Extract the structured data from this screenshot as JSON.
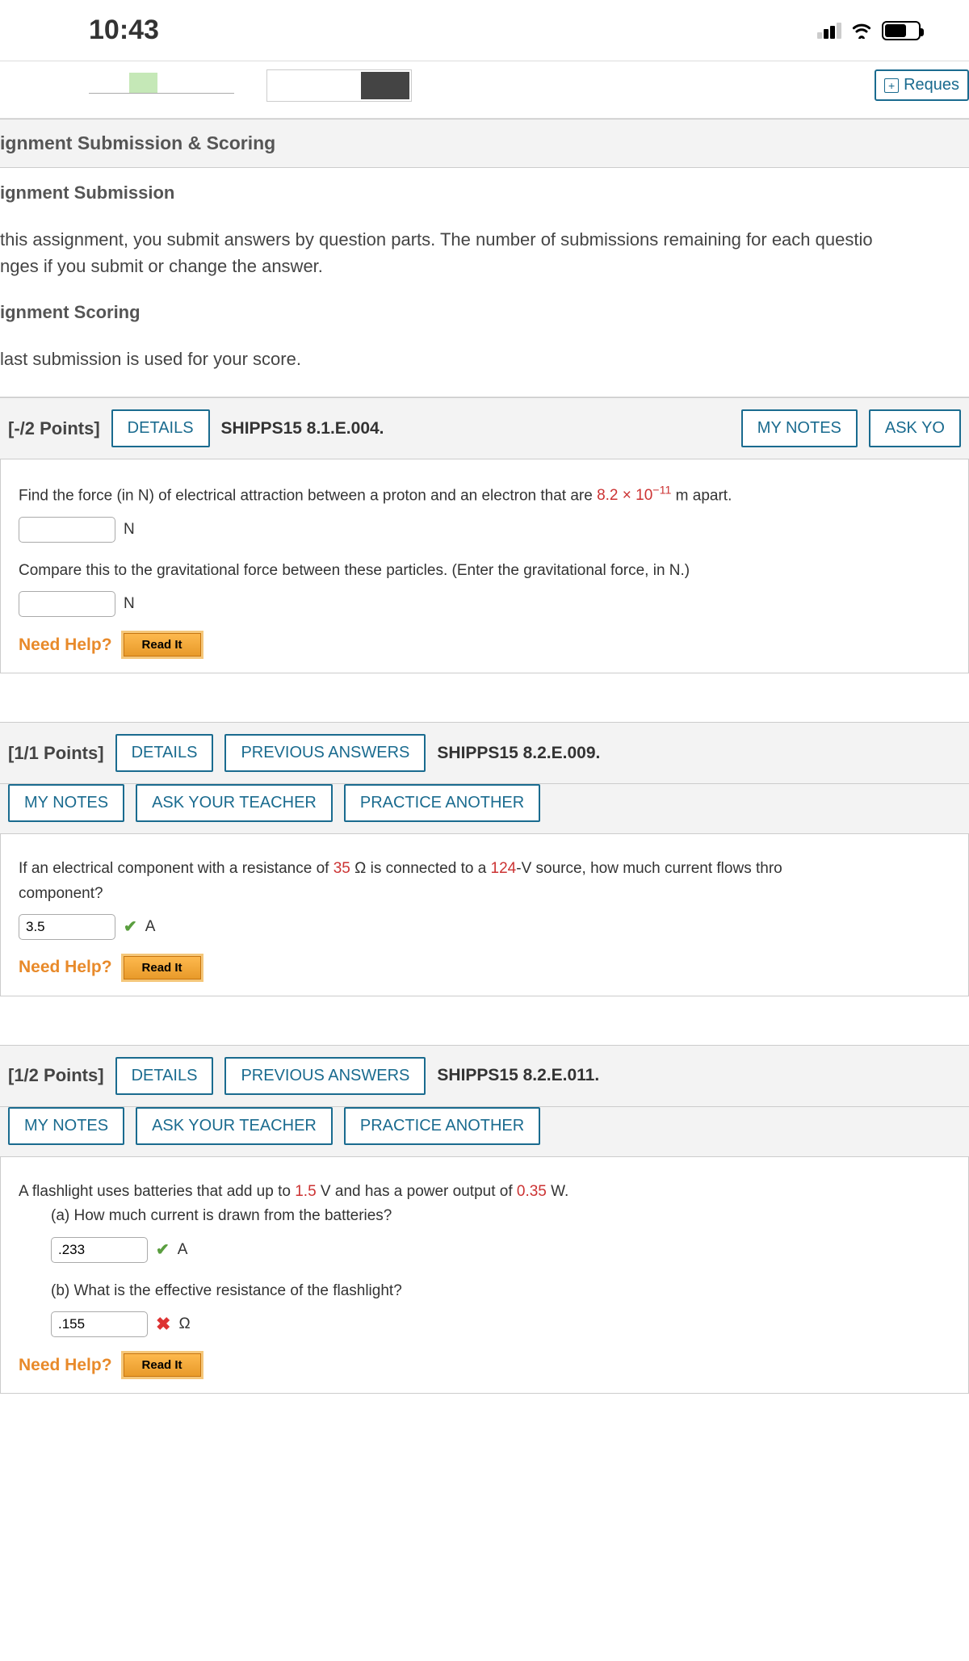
{
  "status": {
    "time": "10:43"
  },
  "top": {
    "request": "Reques"
  },
  "scoring": {
    "header": "ignment Submission & Scoring",
    "sub1": "ignment Submission",
    "text1": "this assignment, you submit answers by question parts. The number of submissions remaining for each questio",
    "text1b": "nges if you submit or change the answer.",
    "sub2": "ignment Scoring",
    "text2": " last submission is used for your score."
  },
  "buttons": {
    "details": "DETAILS",
    "previous": "PREVIOUS ANSWERS",
    "mynotes": "MY NOTES",
    "ask": "ASK YOUR TEACHER",
    "ask_cut": "ASK YO",
    "practice": "PRACTICE ANOTHER",
    "readit": "Read It",
    "needhelp": "Need Help?"
  },
  "q1": {
    "points": "[-/2 Points]",
    "code": "SHIPPS15 8.1.E.004.",
    "p1a": "Find the force (in N) of electrical attraction between a proton and an electron that are ",
    "p1val": "8.2 × 10",
    "p1exp": "−11",
    "p1b": " m apart.",
    "unit": "N",
    "p2": "Compare this to the gravitational force between these particles. (Enter the gravitational force, in N.)"
  },
  "q2": {
    "points": "[1/1 Points]",
    "code": "SHIPPS15 8.2.E.009.",
    "p1a": "If an electrical component with a resistance of ",
    "r": "35",
    "p1b": " Ω is connected to a ",
    "v": "124",
    "p1c": "-V source, how much current flows thro",
    "p1d": "component?",
    "ans": "3.5",
    "unit": "A"
  },
  "q3": {
    "points": "[1/2 Points]",
    "code": "SHIPPS15 8.2.E.011.",
    "p1a": "A flashlight uses batteries that add up to ",
    "v": "1.5",
    "p1b": " V and has a power output of ",
    "p": "0.35",
    "p1c": " W.",
    "qa": "(a) How much current is drawn from the batteries?",
    "ansA": ".233",
    "unitA": "A",
    "qb": "(b) What is the effective resistance of the flashlight?",
    "ansB": ".155",
    "unitB": "Ω"
  }
}
